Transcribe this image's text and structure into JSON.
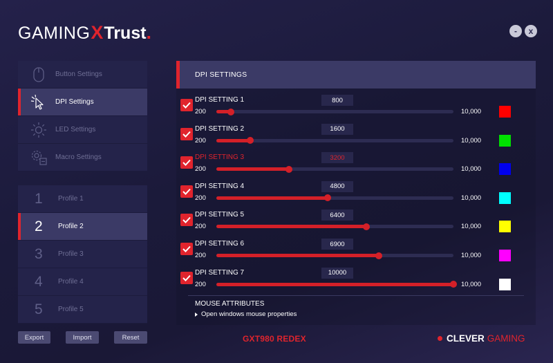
{
  "logo": {
    "part1": "GAMING",
    "part2": "X",
    "part3": "Trust",
    "part4": "."
  },
  "window": {
    "minimize": "-",
    "close": "x"
  },
  "nav": [
    {
      "label": "Button Settings",
      "icon": "mouse-icon",
      "active": false
    },
    {
      "label": "DPI Settings",
      "icon": "cursor-icon",
      "active": true
    },
    {
      "label": "LED Settings",
      "icon": "sun-icon",
      "active": false
    },
    {
      "label": "Macro Settings",
      "icon": "gear-icon",
      "active": false
    }
  ],
  "profiles": [
    {
      "num": "1",
      "label": "Profile 1",
      "active": false
    },
    {
      "num": "2",
      "label": "Profile 2",
      "active": true
    },
    {
      "num": "3",
      "label": "Profile 3",
      "active": false
    },
    {
      "num": "4",
      "label": "Profile 4",
      "active": false
    },
    {
      "num": "5",
      "label": "Profile 5",
      "active": false
    }
  ],
  "buttons": {
    "export": "Export",
    "import": "Import",
    "reset": "Reset"
  },
  "panel": {
    "title": "DPI SETTINGS",
    "min": 200,
    "max": 10000,
    "min_label": "200",
    "max_label": "10,000",
    "settings": [
      {
        "label": "DPI SETTING 1",
        "value": "800",
        "dpi": 800,
        "color": "#ff0000",
        "checked": true,
        "highlight": false
      },
      {
        "label": "DPI SETTING 2",
        "value": "1600",
        "dpi": 1600,
        "color": "#00e000",
        "checked": true,
        "highlight": false
      },
      {
        "label": "DPI SETTING 3",
        "value": "3200",
        "dpi": 3200,
        "color": "#0000ee",
        "checked": true,
        "highlight": true
      },
      {
        "label": "DPI SETTING 4",
        "value": "4800",
        "dpi": 4800,
        "color": "#00ffff",
        "checked": true,
        "highlight": false
      },
      {
        "label": "DPI SETTING 5",
        "value": "6400",
        "dpi": 6400,
        "color": "#ffff00",
        "checked": true,
        "highlight": false
      },
      {
        "label": "DPI SETTING 6",
        "value": "6900",
        "dpi": 6900,
        "color": "#ff00ff",
        "checked": true,
        "highlight": false
      },
      {
        "label": "DPI SETTING 7",
        "value": "10000",
        "dpi": 10000,
        "color": "#ffffff",
        "checked": true,
        "highlight": false
      }
    ],
    "mouse_attributes": {
      "title": "MOUSE ATTRIBUTES",
      "link": "Open windows mouse properties"
    }
  },
  "footer": {
    "model": "GXT980 REDEX",
    "brand1": "CLEVER",
    "brand2": "GAMING"
  },
  "colors": {
    "accent": "#e0242d",
    "panel": "#3b3a66",
    "item": "#24234a"
  }
}
